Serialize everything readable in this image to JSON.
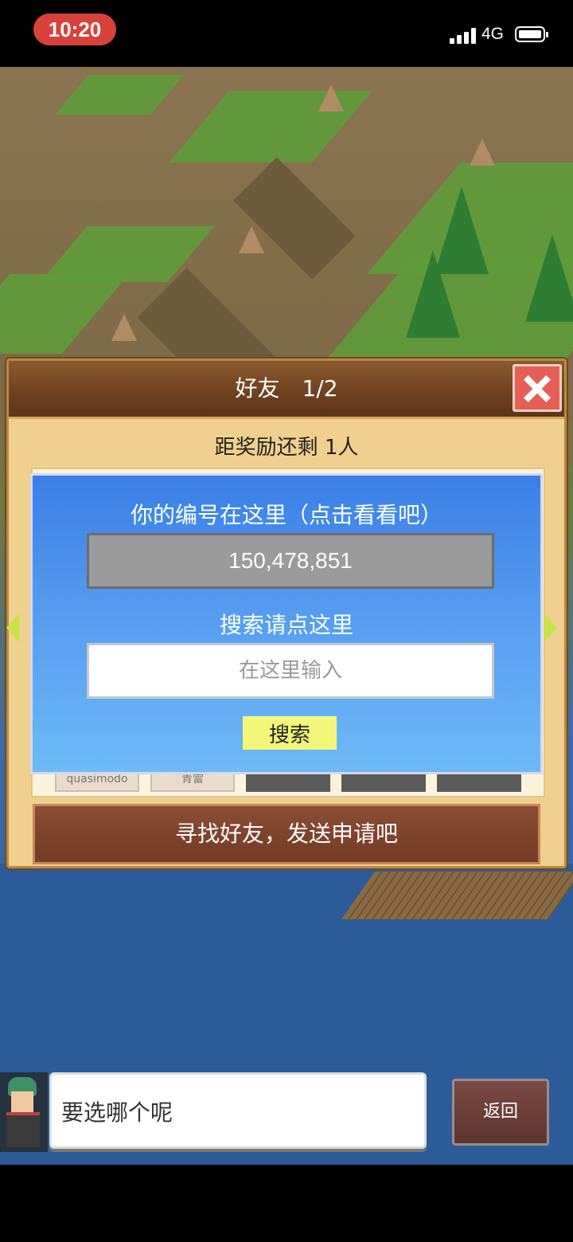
{
  "status_bar": {
    "time": "10:20",
    "network": "4G"
  },
  "dialog": {
    "title": "好友　1/2",
    "reward_text": "距奖励还剩 1人",
    "slots": [
      {
        "name": "quasimodo",
        "state": "filled"
      },
      {
        "name": "青雷",
        "state": "filled"
      },
      {
        "name": "",
        "state": "empty"
      },
      {
        "name": "",
        "state": "empty"
      },
      {
        "name": "",
        "state": "empty"
      }
    ],
    "find_button": "寻找好友，发送申请吧"
  },
  "search_panel": {
    "id_label": "你的编号在这里（点击看看吧）",
    "id_value": "150,478,851",
    "search_label": "搜索请点这里",
    "input_placeholder": "在这里输入",
    "input_value": "",
    "search_button": "搜索"
  },
  "bottom": {
    "speech": "要选哪个呢",
    "back_button": "返回"
  },
  "colors": {
    "panel_blue": "#3a7fe6",
    "search_button_yellow": "#f3f77a",
    "close_red": "#e55f57",
    "header_brown": "#6f4320"
  }
}
